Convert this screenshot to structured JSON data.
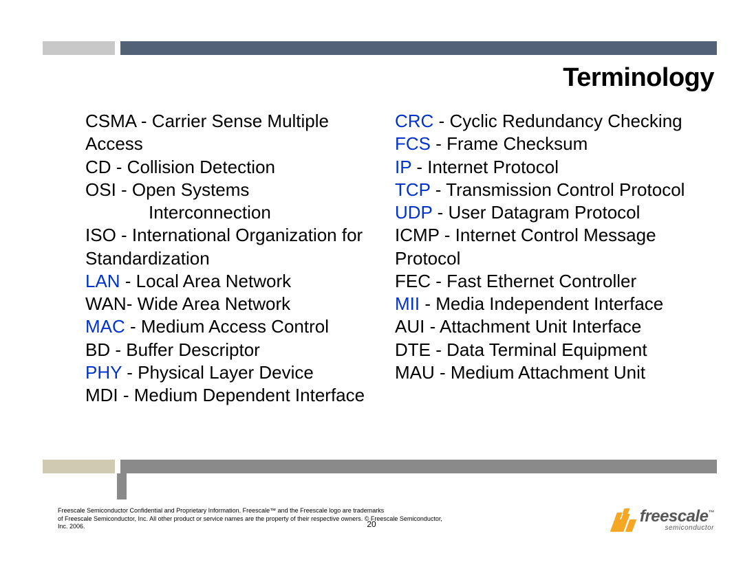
{
  "title": "Terminology",
  "left_col": [
    {
      "abbr": "CSMA",
      "sep": " - ",
      "def": "Carrier Sense Multiple Access",
      "blue": false
    },
    {
      "abbr": "CD",
      "sep": " - ",
      "def": "Collision Detection",
      "blue": false
    },
    {
      "abbr": "OSI",
      "sep": " - ",
      "def": "Open Systems",
      "blue": false,
      "cont": "Interconnection",
      "cont_indent": true
    },
    {
      "abbr": "ISO",
      "sep": " - ",
      "def": "International Organization for Standardization",
      "blue": false
    },
    {
      "abbr": "LAN",
      "sep": " - ",
      "def": "Local Area Network",
      "blue": true
    },
    {
      "abbr": "WAN",
      "sep": "- ",
      "def": "Wide Area Network",
      "blue": false
    },
    {
      "abbr": "MAC",
      "sep": " - ",
      "def": "Medium Access Control",
      "blue": true
    },
    {
      "abbr": "BD",
      "sep": " - ",
      "def": "Buffer Descriptor",
      "blue": false
    },
    {
      "abbr": "PHY",
      "sep": " - ",
      "def": "Physical Layer Device",
      "blue": true
    },
    {
      "abbr": "MDI",
      "sep": " - ",
      "def": "Medium Dependent Interface",
      "blue": false
    }
  ],
  "right_col": [
    {
      "abbr": "CRC",
      "sep": " - ",
      "def": "Cyclic Redundancy Checking",
      "blue": true
    },
    {
      "abbr": "FCS",
      "sep": " - ",
      "def": "Frame Checksum",
      "blue": true
    },
    {
      "abbr": "IP",
      "sep": " - ",
      "def": "Internet Protocol",
      "blue": true
    },
    {
      "abbr": "TCP",
      "sep": " - ",
      "def": "Transmission Control Protocol",
      "blue": true
    },
    {
      "abbr": "UDP",
      "sep": " - ",
      "def": "User Datagram Protocol",
      "blue": true
    },
    {
      "abbr": "ICMP",
      "sep": " - ",
      "def": "Internet Control Message Protocol",
      "blue": false
    },
    {
      "abbr": "FEC",
      "sep": " - ",
      "def": "Fast Ethernet Controller",
      "blue": false
    },
    {
      "abbr": "MII",
      "sep": " - ",
      "def": "Media Independent Interface",
      "blue": true
    },
    {
      "abbr": "AUI",
      "sep": " - ",
      "def": "Attachment Unit Interface",
      "blue": false
    },
    {
      "abbr": "DTE",
      "sep": " - ",
      "def": "Data Terminal Equipment",
      "blue": false
    },
    {
      "abbr": "MAU",
      "sep": " - ",
      "def": "Medium Attachment Unit",
      "blue": false
    }
  ],
  "footer": {
    "legal_line1": "Freescale Semiconductor Confidential and Proprietary Information. Freescale™ and the Freescale logo are trademarks",
    "legal_line2": "of Freescale Semiconductor, Inc. All other product or service names are the property of their respective owners. © Freescale Semiconductor, Inc. 2006.",
    "page": "20",
    "logo_main": "freescale",
    "logo_tm": "™",
    "logo_sub": "semiconductor"
  }
}
